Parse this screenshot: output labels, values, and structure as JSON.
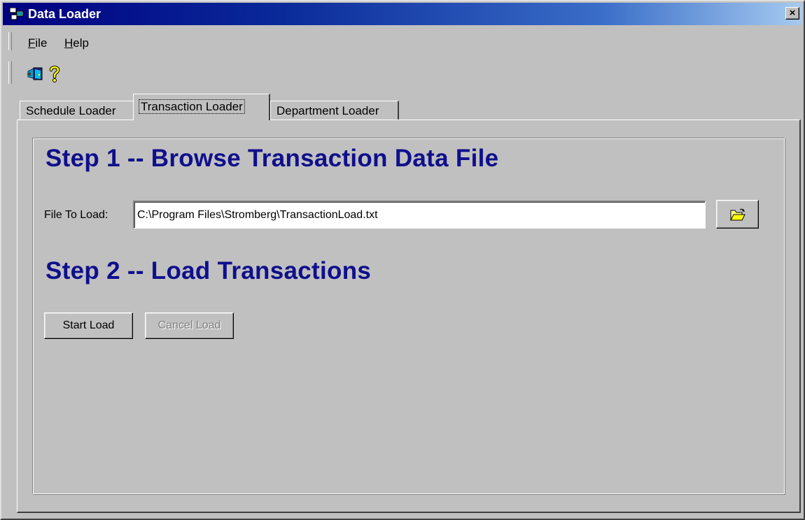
{
  "window": {
    "title": "Data Loader",
    "close_label": "×"
  },
  "menu": {
    "items": [
      {
        "label": "File",
        "mnemonic": "F",
        "rest": "ile"
      },
      {
        "label": "Help",
        "mnemonic": "H",
        "rest": "elp"
      }
    ]
  },
  "toolbar": {
    "buttons": [
      {
        "icon": "exit-door-icon"
      },
      {
        "icon": "help-question-icon"
      }
    ]
  },
  "tabs": [
    {
      "label": "Schedule Loader",
      "active": false
    },
    {
      "label": "Transaction Loader",
      "active": true
    },
    {
      "label": "Department Loader",
      "active": false
    }
  ],
  "step1": {
    "heading": "Step 1 -- Browse Transaction Data File",
    "file_label": "File To Load:",
    "file_value": "C:\\Program Files\\Stromberg\\TransactionLoad.txt",
    "browse_icon": "open-folder-icon"
  },
  "step2": {
    "heading": "Step 2 -- Load Transactions",
    "start_label": "Start Load",
    "cancel_label": "Cancel Load",
    "cancel_enabled": false
  },
  "colors": {
    "heading": "#0f0f8c",
    "titlebar_start": "#000080",
    "face": "#c0c0c0"
  }
}
